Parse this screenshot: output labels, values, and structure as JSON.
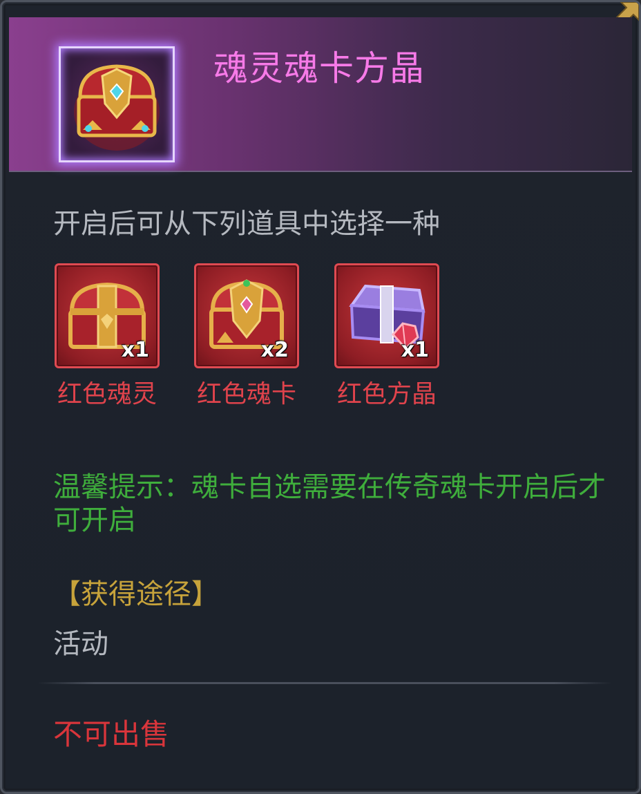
{
  "item": {
    "title": "魂灵魂卡方晶",
    "icon": "red-gold-treasure-chest-icon"
  },
  "description": "开启后可从下列道具中选择一种",
  "rewards": [
    {
      "name": "红色魂灵",
      "count": "x1",
      "icon": "red-gold-chest-icon"
    },
    {
      "name": "红色魂卡",
      "count": "x2",
      "icon": "red-ornate-chest-icon"
    },
    {
      "name": "红色方晶",
      "count": "x1",
      "icon": "purple-chest-red-gem-icon"
    }
  ],
  "tip": "温馨提示：魂卡自选需要在传奇魂卡开启后才可开启",
  "source": {
    "title": "【获得途径】",
    "value": "活动"
  },
  "sell_status": "不可出售",
  "colors": {
    "title": "#f77ae8",
    "reward_name": "#e0434c",
    "tip": "#3fae3c",
    "source_title": "#c7a33b",
    "sell_status": "#d9353b"
  }
}
